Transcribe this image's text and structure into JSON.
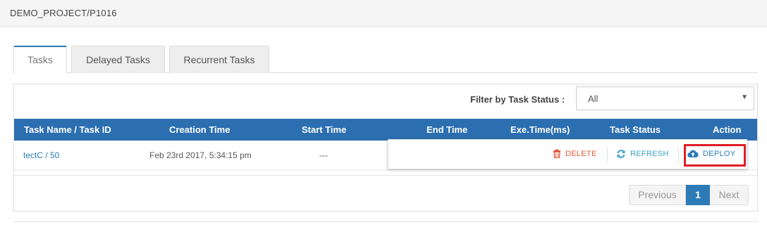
{
  "header": {
    "breadcrumb": "DEMO_PROJECT/P1016"
  },
  "tabs": [
    {
      "label": "Tasks",
      "active": true
    },
    {
      "label": "Delayed Tasks",
      "active": false
    },
    {
      "label": "Recurrent Tasks",
      "active": false
    }
  ],
  "filter": {
    "label": "Filter by Task Status :",
    "selected": "All"
  },
  "table": {
    "columns": [
      "Task Name / Task ID",
      "Creation Time",
      "Start Time",
      "End Time",
      "Exe.Time(ms)",
      "Task Status",
      "Action"
    ],
    "rows": [
      {
        "task": "tectC / 50",
        "creation_time": "Feb 23rd 2017, 5:34:15 pm",
        "start_time": "---"
      }
    ]
  },
  "actions": {
    "delete": {
      "label": "DELETE",
      "icon": "trash-icon",
      "color": "#e05a3a"
    },
    "refresh": {
      "label": "REFRESH",
      "icon": "refresh-icon",
      "color": "#3aa0c8"
    },
    "deploy": {
      "label": "DEPLOY",
      "icon": "cloud-upload-icon",
      "color": "#2c7bb6"
    }
  },
  "pagination": {
    "previous": "Previous",
    "current": "1",
    "next": "Next"
  },
  "colors": {
    "header_blue": "#2c6fb0",
    "accent": "#2c7bb6",
    "highlight": "#e01c24"
  }
}
